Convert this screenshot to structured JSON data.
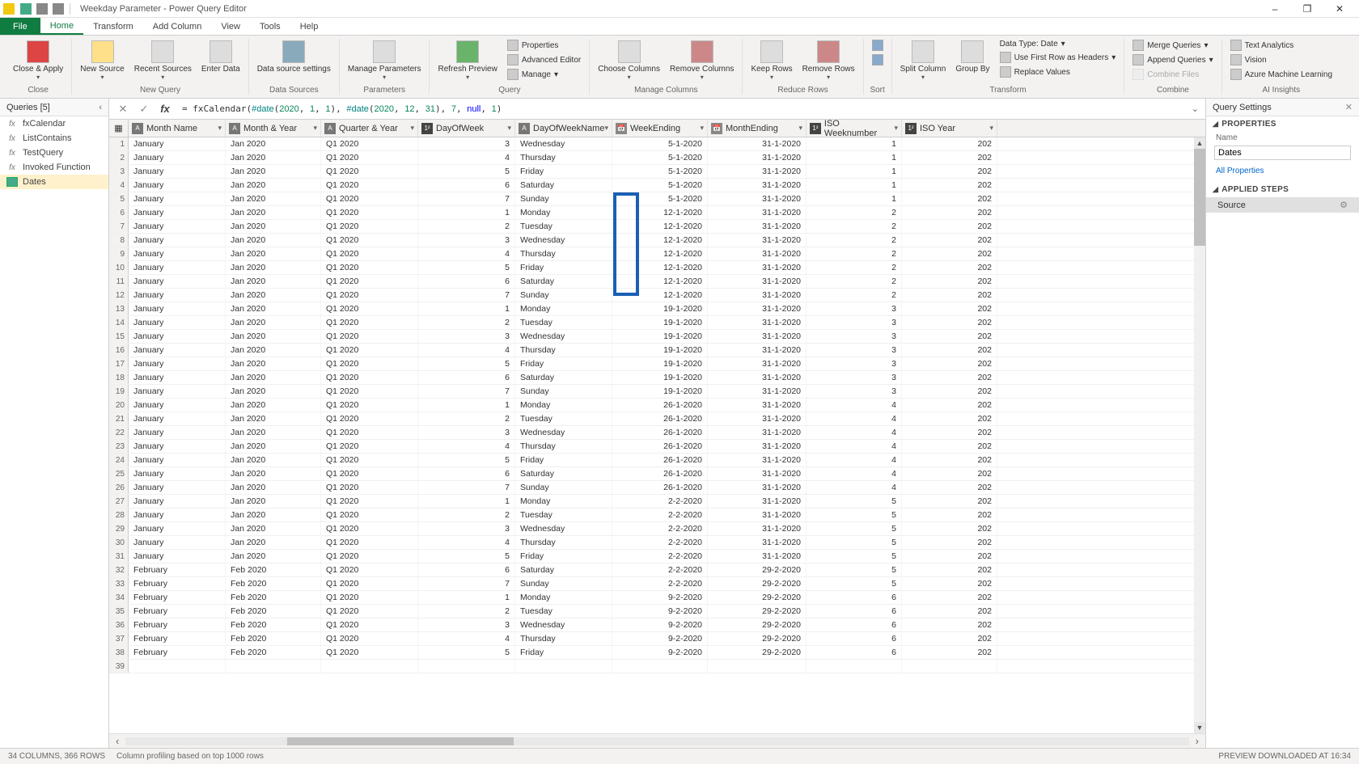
{
  "window": {
    "title": "Weekday Parameter - Power Query Editor",
    "minimize": "–",
    "maximize": "❐",
    "close": "✕"
  },
  "ribbon_tabs": {
    "file": "File",
    "home": "Home",
    "transform": "Transform",
    "add_column": "Add Column",
    "view": "View",
    "tools": "Tools",
    "help": "Help"
  },
  "ribbon": {
    "close_apply": "Close &\nApply",
    "new_source": "New\nSource",
    "recent_sources": "Recent\nSources",
    "enter_data": "Enter\nData",
    "data_source_settings": "Data source\nsettings",
    "manage_parameters": "Manage\nParameters",
    "refresh_preview": "Refresh\nPreview",
    "properties": "Properties",
    "advanced_editor": "Advanced Editor",
    "manage": "Manage",
    "choose_columns": "Choose\nColumns",
    "remove_columns": "Remove\nColumns",
    "keep_rows": "Keep\nRows",
    "remove_rows": "Remove\nRows",
    "sort": "Sort",
    "split_column": "Split\nColumn",
    "group_by": "Group\nBy",
    "data_type": "Data Type: Date",
    "first_row_headers": "Use First Row as Headers",
    "replace_values": "Replace Values",
    "merge_queries": "Merge Queries",
    "append_queries": "Append Queries",
    "combine_files": "Combine Files",
    "text_analytics": "Text Analytics",
    "vision": "Vision",
    "azure_ml": "Azure Machine Learning",
    "groups": {
      "close": "Close",
      "new_query": "New Query",
      "data_sources": "Data Sources",
      "parameters": "Parameters",
      "query": "Query",
      "manage_columns": "Manage Columns",
      "reduce_rows": "Reduce Rows",
      "sort_g": "Sort",
      "transform": "Transform",
      "combine": "Combine",
      "ai_insights": "AI Insights"
    }
  },
  "queries_pane": {
    "title": "Queries [5]",
    "items": [
      {
        "icon": "fx",
        "label": "fxCalendar"
      },
      {
        "icon": "fx",
        "label": "ListContains"
      },
      {
        "icon": "fx",
        "label": "TestQuery"
      },
      {
        "icon": "fx",
        "label": "Invoked Function"
      },
      {
        "icon": "tbl",
        "label": "Dates"
      }
    ]
  },
  "formula_bar": {
    "prefix": "= fxCalendar(",
    "d1": "#date",
    "p1": "(",
    "n1": "2020",
    "c": ", ",
    "n2": "1",
    "n3": "1",
    "p2": ")",
    "n4": "2020",
    "n5": "12",
    "n6": "31",
    "n7": "7",
    "null": "null",
    "n8": "1",
    "suffix": ")"
  },
  "columns": [
    {
      "type": "ABC",
      "name": "Month Name",
      "cls": "cw-monthname"
    },
    {
      "type": "ABC",
      "name": "Month & Year",
      "cls": "cw-monthyear"
    },
    {
      "type": "ABC",
      "name": "Quarter & Year",
      "cls": "cw-quarteryear"
    },
    {
      "type": "123",
      "name": "DayOfWeek",
      "cls": "cw-dayofweek"
    },
    {
      "type": "ABC",
      "name": "DayOfWeekName",
      "cls": "cw-downame"
    },
    {
      "type": "cal",
      "name": "WeekEnding",
      "cls": "cw-weekending"
    },
    {
      "type": "cal",
      "name": "MonthEnding",
      "cls": "cw-monthending"
    },
    {
      "type": "123",
      "name": "ISO Weeknumber",
      "cls": "cw-isoweek"
    },
    {
      "type": "123",
      "name": "ISO Year",
      "cls": "cw-isoyear"
    }
  ],
  "rows": [
    {
      "n": 1,
      "mn": "January",
      "my": "Jan 2020",
      "qy": "Q1 2020",
      "dow": 3,
      "down": "Wednesday",
      "we": "5-1-2020",
      "me": "31-1-2020",
      "iw": 1,
      "iy": "202"
    },
    {
      "n": 2,
      "mn": "January",
      "my": "Jan 2020",
      "qy": "Q1 2020",
      "dow": 4,
      "down": "Thursday",
      "we": "5-1-2020",
      "me": "31-1-2020",
      "iw": 1,
      "iy": "202"
    },
    {
      "n": 3,
      "mn": "January",
      "my": "Jan 2020",
      "qy": "Q1 2020",
      "dow": 5,
      "down": "Friday",
      "we": "5-1-2020",
      "me": "31-1-2020",
      "iw": 1,
      "iy": "202"
    },
    {
      "n": 4,
      "mn": "January",
      "my": "Jan 2020",
      "qy": "Q1 2020",
      "dow": 6,
      "down": "Saturday",
      "we": "5-1-2020",
      "me": "31-1-2020",
      "iw": 1,
      "iy": "202"
    },
    {
      "n": 5,
      "mn": "January",
      "my": "Jan 2020",
      "qy": "Q1 2020",
      "dow": 7,
      "down": "Sunday",
      "we": "5-1-2020",
      "me": "31-1-2020",
      "iw": 1,
      "iy": "202"
    },
    {
      "n": 6,
      "mn": "January",
      "my": "Jan 2020",
      "qy": "Q1 2020",
      "dow": 1,
      "down": "Monday",
      "we": "12-1-2020",
      "me": "31-1-2020",
      "iw": 2,
      "iy": "202"
    },
    {
      "n": 7,
      "mn": "January",
      "my": "Jan 2020",
      "qy": "Q1 2020",
      "dow": 2,
      "down": "Tuesday",
      "we": "12-1-2020",
      "me": "31-1-2020",
      "iw": 2,
      "iy": "202"
    },
    {
      "n": 8,
      "mn": "January",
      "my": "Jan 2020",
      "qy": "Q1 2020",
      "dow": 3,
      "down": "Wednesday",
      "we": "12-1-2020",
      "me": "31-1-2020",
      "iw": 2,
      "iy": "202"
    },
    {
      "n": 9,
      "mn": "January",
      "my": "Jan 2020",
      "qy": "Q1 2020",
      "dow": 4,
      "down": "Thursday",
      "we": "12-1-2020",
      "me": "31-1-2020",
      "iw": 2,
      "iy": "202"
    },
    {
      "n": 10,
      "mn": "January",
      "my": "Jan 2020",
      "qy": "Q1 2020",
      "dow": 5,
      "down": "Friday",
      "we": "12-1-2020",
      "me": "31-1-2020",
      "iw": 2,
      "iy": "202"
    },
    {
      "n": 11,
      "mn": "January",
      "my": "Jan 2020",
      "qy": "Q1 2020",
      "dow": 6,
      "down": "Saturday",
      "we": "12-1-2020",
      "me": "31-1-2020",
      "iw": 2,
      "iy": "202"
    },
    {
      "n": 12,
      "mn": "January",
      "my": "Jan 2020",
      "qy": "Q1 2020",
      "dow": 7,
      "down": "Sunday",
      "we": "12-1-2020",
      "me": "31-1-2020",
      "iw": 2,
      "iy": "202"
    },
    {
      "n": 13,
      "mn": "January",
      "my": "Jan 2020",
      "qy": "Q1 2020",
      "dow": 1,
      "down": "Monday",
      "we": "19-1-2020",
      "me": "31-1-2020",
      "iw": 3,
      "iy": "202"
    },
    {
      "n": 14,
      "mn": "January",
      "my": "Jan 2020",
      "qy": "Q1 2020",
      "dow": 2,
      "down": "Tuesday",
      "we": "19-1-2020",
      "me": "31-1-2020",
      "iw": 3,
      "iy": "202"
    },
    {
      "n": 15,
      "mn": "January",
      "my": "Jan 2020",
      "qy": "Q1 2020",
      "dow": 3,
      "down": "Wednesday",
      "we": "19-1-2020",
      "me": "31-1-2020",
      "iw": 3,
      "iy": "202"
    },
    {
      "n": 16,
      "mn": "January",
      "my": "Jan 2020",
      "qy": "Q1 2020",
      "dow": 4,
      "down": "Thursday",
      "we": "19-1-2020",
      "me": "31-1-2020",
      "iw": 3,
      "iy": "202"
    },
    {
      "n": 17,
      "mn": "January",
      "my": "Jan 2020",
      "qy": "Q1 2020",
      "dow": 5,
      "down": "Friday",
      "we": "19-1-2020",
      "me": "31-1-2020",
      "iw": 3,
      "iy": "202"
    },
    {
      "n": 18,
      "mn": "January",
      "my": "Jan 2020",
      "qy": "Q1 2020",
      "dow": 6,
      "down": "Saturday",
      "we": "19-1-2020",
      "me": "31-1-2020",
      "iw": 3,
      "iy": "202"
    },
    {
      "n": 19,
      "mn": "January",
      "my": "Jan 2020",
      "qy": "Q1 2020",
      "dow": 7,
      "down": "Sunday",
      "we": "19-1-2020",
      "me": "31-1-2020",
      "iw": 3,
      "iy": "202"
    },
    {
      "n": 20,
      "mn": "January",
      "my": "Jan 2020",
      "qy": "Q1 2020",
      "dow": 1,
      "down": "Monday",
      "we": "26-1-2020",
      "me": "31-1-2020",
      "iw": 4,
      "iy": "202"
    },
    {
      "n": 21,
      "mn": "January",
      "my": "Jan 2020",
      "qy": "Q1 2020",
      "dow": 2,
      "down": "Tuesday",
      "we": "26-1-2020",
      "me": "31-1-2020",
      "iw": 4,
      "iy": "202"
    },
    {
      "n": 22,
      "mn": "January",
      "my": "Jan 2020",
      "qy": "Q1 2020",
      "dow": 3,
      "down": "Wednesday",
      "we": "26-1-2020",
      "me": "31-1-2020",
      "iw": 4,
      "iy": "202"
    },
    {
      "n": 23,
      "mn": "January",
      "my": "Jan 2020",
      "qy": "Q1 2020",
      "dow": 4,
      "down": "Thursday",
      "we": "26-1-2020",
      "me": "31-1-2020",
      "iw": 4,
      "iy": "202"
    },
    {
      "n": 24,
      "mn": "January",
      "my": "Jan 2020",
      "qy": "Q1 2020",
      "dow": 5,
      "down": "Friday",
      "we": "26-1-2020",
      "me": "31-1-2020",
      "iw": 4,
      "iy": "202"
    },
    {
      "n": 25,
      "mn": "January",
      "my": "Jan 2020",
      "qy": "Q1 2020",
      "dow": 6,
      "down": "Saturday",
      "we": "26-1-2020",
      "me": "31-1-2020",
      "iw": 4,
      "iy": "202"
    },
    {
      "n": 26,
      "mn": "January",
      "my": "Jan 2020",
      "qy": "Q1 2020",
      "dow": 7,
      "down": "Sunday",
      "we": "26-1-2020",
      "me": "31-1-2020",
      "iw": 4,
      "iy": "202"
    },
    {
      "n": 27,
      "mn": "January",
      "my": "Jan 2020",
      "qy": "Q1 2020",
      "dow": 1,
      "down": "Monday",
      "we": "2-2-2020",
      "me": "31-1-2020",
      "iw": 5,
      "iy": "202"
    },
    {
      "n": 28,
      "mn": "January",
      "my": "Jan 2020",
      "qy": "Q1 2020",
      "dow": 2,
      "down": "Tuesday",
      "we": "2-2-2020",
      "me": "31-1-2020",
      "iw": 5,
      "iy": "202"
    },
    {
      "n": 29,
      "mn": "January",
      "my": "Jan 2020",
      "qy": "Q1 2020",
      "dow": 3,
      "down": "Wednesday",
      "we": "2-2-2020",
      "me": "31-1-2020",
      "iw": 5,
      "iy": "202"
    },
    {
      "n": 30,
      "mn": "January",
      "my": "Jan 2020",
      "qy": "Q1 2020",
      "dow": 4,
      "down": "Thursday",
      "we": "2-2-2020",
      "me": "31-1-2020",
      "iw": 5,
      "iy": "202"
    },
    {
      "n": 31,
      "mn": "January",
      "my": "Jan 2020",
      "qy": "Q1 2020",
      "dow": 5,
      "down": "Friday",
      "we": "2-2-2020",
      "me": "31-1-2020",
      "iw": 5,
      "iy": "202"
    },
    {
      "n": 32,
      "mn": "February",
      "my": "Feb 2020",
      "qy": "Q1 2020",
      "dow": 6,
      "down": "Saturday",
      "we": "2-2-2020",
      "me": "29-2-2020",
      "iw": 5,
      "iy": "202"
    },
    {
      "n": 33,
      "mn": "February",
      "my": "Feb 2020",
      "qy": "Q1 2020",
      "dow": 7,
      "down": "Sunday",
      "we": "2-2-2020",
      "me": "29-2-2020",
      "iw": 5,
      "iy": "202"
    },
    {
      "n": 34,
      "mn": "February",
      "my": "Feb 2020",
      "qy": "Q1 2020",
      "dow": 1,
      "down": "Monday",
      "we": "9-2-2020",
      "me": "29-2-2020",
      "iw": 6,
      "iy": "202"
    },
    {
      "n": 35,
      "mn": "February",
      "my": "Feb 2020",
      "qy": "Q1 2020",
      "dow": 2,
      "down": "Tuesday",
      "we": "9-2-2020",
      "me": "29-2-2020",
      "iw": 6,
      "iy": "202"
    },
    {
      "n": 36,
      "mn": "February",
      "my": "Feb 2020",
      "qy": "Q1 2020",
      "dow": 3,
      "down": "Wednesday",
      "we": "9-2-2020",
      "me": "29-2-2020",
      "iw": 6,
      "iy": "202"
    },
    {
      "n": 37,
      "mn": "February",
      "my": "Feb 2020",
      "qy": "Q1 2020",
      "dow": 4,
      "down": "Thursday",
      "we": "9-2-2020",
      "me": "29-2-2020",
      "iw": 6,
      "iy": "202"
    },
    {
      "n": 38,
      "mn": "February",
      "my": "Feb 2020",
      "qy": "Q1 2020",
      "dow": 5,
      "down": "Friday",
      "we": "9-2-2020",
      "me": "29-2-2020",
      "iw": 6,
      "iy": "202"
    },
    {
      "n": 39,
      "mn": "",
      "my": "",
      "qy": "",
      "dow": "",
      "down": "",
      "we": "",
      "me": "",
      "iw": "",
      "iy": ""
    }
  ],
  "settings": {
    "title": "Query Settings",
    "properties": "PROPERTIES",
    "name_label": "Name",
    "name_value": "Dates",
    "all_properties": "All Properties",
    "applied_steps": "APPLIED STEPS",
    "step_source": "Source"
  },
  "statusbar": {
    "left": "34 COLUMNS, 366 ROWS",
    "mid": "Column profiling based on top 1000 rows",
    "right": "PREVIEW DOWNLOADED AT 16:34"
  }
}
